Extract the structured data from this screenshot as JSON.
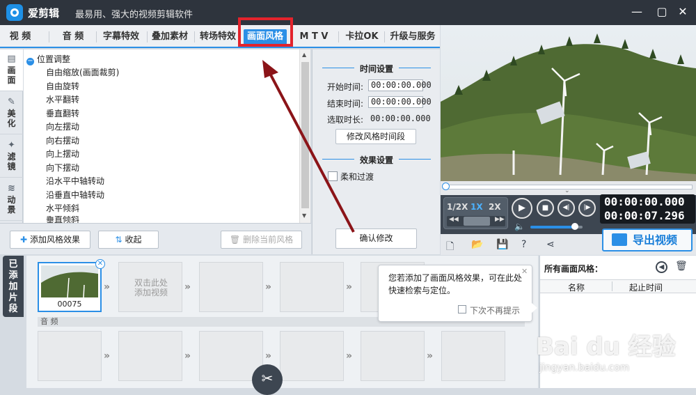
{
  "window": {
    "app_name": "爱剪辑",
    "slogan": "最易用、强大的视频剪辑软件",
    "minimize": "—",
    "maximize": "▢",
    "close": "✕"
  },
  "tabs": [
    {
      "label": "视 频"
    },
    {
      "label": "音 频"
    },
    {
      "label": "字幕特效"
    },
    {
      "label": "叠加素材"
    },
    {
      "label": "转场特效"
    },
    {
      "label": "画面风格"
    },
    {
      "label": "M T V"
    },
    {
      "label": "卡拉OK"
    },
    {
      "label": "升级与服务"
    }
  ],
  "side_tabs": [
    {
      "label": "画面",
      "icon": "picture-icon"
    },
    {
      "label": "美化",
      "icon": "wand-icon"
    },
    {
      "label": "滤镜",
      "icon": "sparkle-icon"
    },
    {
      "label": "动景",
      "icon": "wave-icon"
    }
  ],
  "tree": {
    "root": "位置调整",
    "items": [
      "自由缩放(画面裁剪)",
      "自由旋转",
      "水平翻转",
      "垂直翻转",
      "向左摆动",
      "向右摆动",
      "向上摆动",
      "向下摆动",
      "沿水平中轴转动",
      "沿垂直中轴转动",
      "水平倾斜",
      "垂直倾斜"
    ]
  },
  "toolbar": {
    "add_effect": "添加风格效果",
    "collapse": "收起",
    "delete": "删除当前风格"
  },
  "time_settings": {
    "heading": "时间设置",
    "start_label": "开始时间:",
    "start_value": "00:00:00.000",
    "end_label": "结束时间:",
    "end_value": "00:00:00.000",
    "duration_label": "选取时长:",
    "duration_value": "00:00:00.000",
    "modify_button": "修改风格时间段"
  },
  "effect_settings": {
    "heading": "效果设置",
    "smooth_label": "柔和过渡",
    "confirm_button": "确认修改"
  },
  "player": {
    "speeds": [
      "1/2X",
      "1X",
      "2X"
    ],
    "selected_speed": "1X",
    "current_time": "00:00:00.000",
    "total_time": "00:00:07.296",
    "volume": 0.85,
    "progress": 0.0
  },
  "export": {
    "label": "导出视频"
  },
  "added_clips": {
    "label": [
      "已",
      "添",
      "加",
      "片",
      "段"
    ],
    "first_clip_name": "00075",
    "add_video_hint_line1": "双击此处",
    "add_video_hint_line2": "添加视频",
    "audio_label": "音 频"
  },
  "tooltip": {
    "text": "您若添加了画面风格效果，可在此处快速检索与定位。",
    "checkbox_label": "下次不再提示",
    "close": "✕"
  },
  "styles_panel": {
    "title": "所有画面风格：",
    "col_name": "名称",
    "col_start": "起止时间"
  },
  "watermark": {
    "logo": "Bai du 经验",
    "url": "jingyan.baidu.com"
  },
  "colors": {
    "accent": "#2b8fe6",
    "highlight": "#e3232c",
    "titlebar": "#2e343d"
  }
}
